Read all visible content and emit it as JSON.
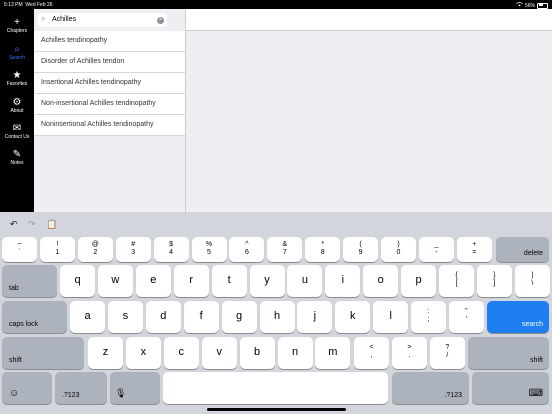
{
  "status": {
    "time": "5:13 PM",
    "date": "Wed Feb 26",
    "battery": "56%"
  },
  "sidebar": {
    "items": [
      {
        "label": "Chapters",
        "icon": "+"
      },
      {
        "label": "Search",
        "icon": "⌕"
      },
      {
        "label": "Favorites",
        "icon": "★"
      },
      {
        "label": "About",
        "icon": "⚙"
      },
      {
        "label": "Contact Us",
        "icon": "✉"
      },
      {
        "label": "Notes",
        "icon": "✎"
      }
    ]
  },
  "search": {
    "value": "Achilles",
    "results": [
      "Achilles tendinopathy",
      "Disorder of Achilles tendon",
      "Insertional Achilles tendinopathy",
      "Non-insertional Achilles tendinopathy",
      "Noninsertional Achilles tendinopathy"
    ]
  },
  "keyboard": {
    "row1": [
      {
        "top": "~",
        "bottom": "`"
      },
      {
        "top": "!",
        "bottom": "1"
      },
      {
        "top": "@",
        "bottom": "2"
      },
      {
        "top": "#",
        "bottom": "3"
      },
      {
        "top": "$",
        "bottom": "4"
      },
      {
        "top": "%",
        "bottom": "5"
      },
      {
        "top": "^",
        "bottom": "6"
      },
      {
        "top": "&",
        "bottom": "7"
      },
      {
        "top": "*",
        "bottom": "8"
      },
      {
        "top": "(",
        "bottom": "9"
      },
      {
        "top": ")",
        "bottom": "0"
      },
      {
        "top": "_",
        "bottom": "-"
      },
      {
        "top": "+",
        "bottom": "="
      }
    ],
    "delete": "delete",
    "tab": "tab",
    "row2": [
      "q",
      "w",
      "e",
      "r",
      "t",
      "y",
      "u",
      "i",
      "o",
      "p"
    ],
    "row2_extra": [
      {
        "top": "{",
        "bottom": "["
      },
      {
        "top": "}",
        "bottom": "]"
      },
      {
        "top": "|",
        "bottom": "\\"
      }
    ],
    "caps": "caps lock",
    "row3": [
      "a",
      "s",
      "d",
      "f",
      "g",
      "h",
      "j",
      "k",
      "l"
    ],
    "row3_extra": [
      {
        "top": ":",
        "bottom": ";"
      },
      {
        "top": "\"",
        "bottom": "'"
      }
    ],
    "search": "search",
    "shift": "shift",
    "row4": [
      "z",
      "x",
      "c",
      "v",
      "b",
      "n",
      "m"
    ],
    "row4_extra": [
      {
        "top": "<",
        "bottom": ","
      },
      {
        "top": ">",
        "bottom": "."
      },
      {
        "top": "?",
        "bottom": "/"
      }
    ],
    "numbers": ".?123",
    "emoji": "☺",
    "mic": "🎙",
    "hide": "⌨"
  }
}
